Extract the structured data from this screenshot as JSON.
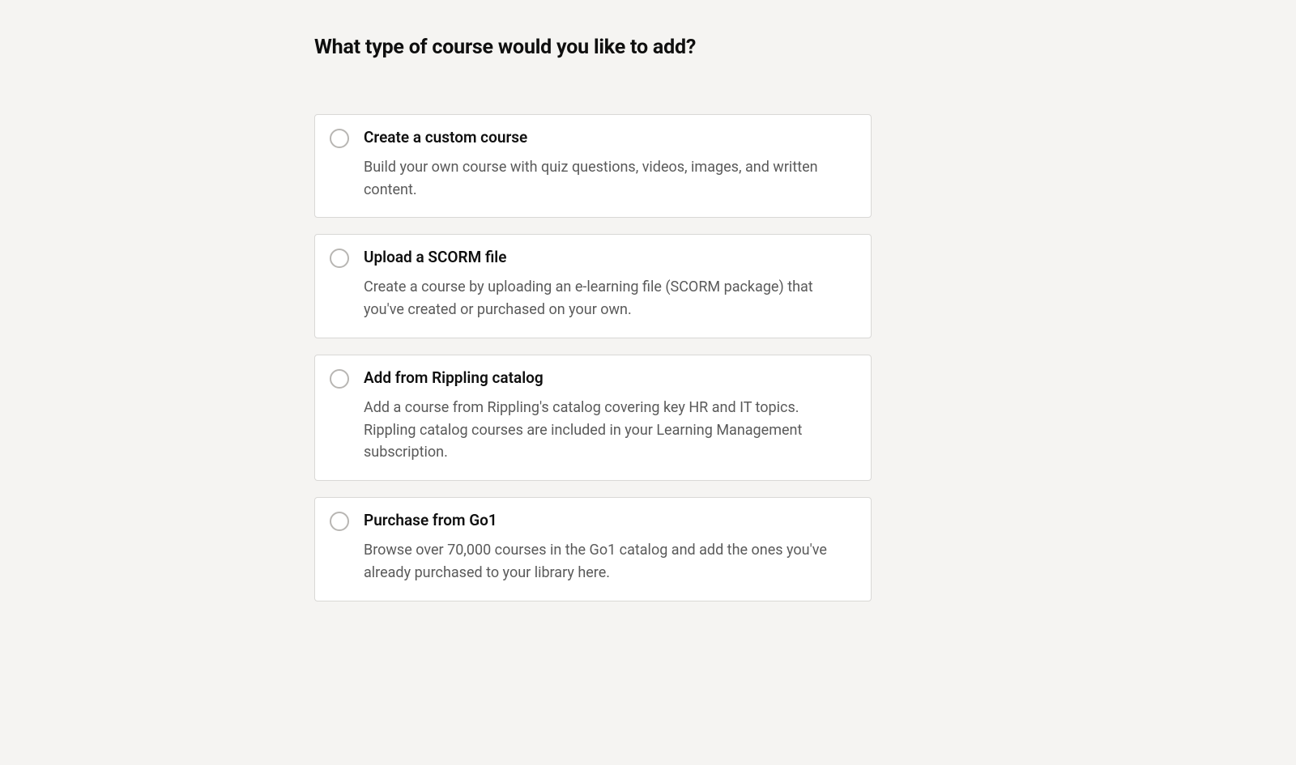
{
  "heading": "What type of course would you like to add?",
  "options": [
    {
      "title": "Create a custom course",
      "description": "Build your own course with quiz questions, videos, images, and written content."
    },
    {
      "title": "Upload a SCORM file",
      "description": "Create a course by uploading an e-learning file (SCORM package) that you've created or purchased on your own."
    },
    {
      "title": "Add from Rippling catalog",
      "description": "Add a course from Rippling's catalog covering key HR and IT topics. Rippling catalog courses are included in your Learning Management subscription."
    },
    {
      "title": "Purchase from Go1",
      "description": "Browse over 70,000 courses in the Go1 catalog and add the ones you've already purchased to your library here."
    }
  ]
}
